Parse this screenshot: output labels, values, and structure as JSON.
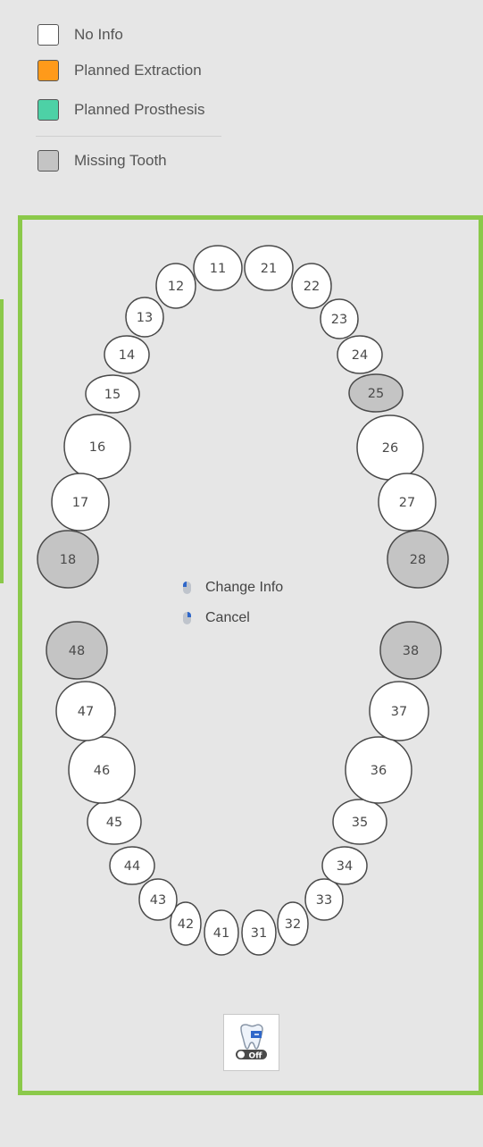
{
  "legend": {
    "items": [
      {
        "label": "No Info",
        "color": "#ffffff"
      },
      {
        "label": "Planned Extraction",
        "color": "#ff9a1a"
      },
      {
        "label": "Planned Prosthesis",
        "color": "#4dd1a6"
      },
      {
        "label": "Missing Tooth",
        "color": "#c4c4c4"
      }
    ]
  },
  "colors": {
    "panel_border": "#8bc94a",
    "tooth_fill": "#ffffff",
    "missing_fill": "#c4c4c4",
    "tooth_stroke": "#4a4a4a"
  },
  "teeth": [
    {
      "number": "11",
      "status": "no-info"
    },
    {
      "number": "12",
      "status": "no-info"
    },
    {
      "number": "13",
      "status": "no-info"
    },
    {
      "number": "14",
      "status": "no-info"
    },
    {
      "number": "15",
      "status": "no-info"
    },
    {
      "number": "16",
      "status": "no-info"
    },
    {
      "number": "17",
      "status": "no-info"
    },
    {
      "number": "18",
      "status": "missing"
    },
    {
      "number": "21",
      "status": "no-info"
    },
    {
      "number": "22",
      "status": "no-info"
    },
    {
      "number": "23",
      "status": "no-info"
    },
    {
      "number": "24",
      "status": "no-info"
    },
    {
      "number": "25",
      "status": "missing"
    },
    {
      "number": "26",
      "status": "no-info"
    },
    {
      "number": "27",
      "status": "no-info"
    },
    {
      "number": "28",
      "status": "missing"
    },
    {
      "number": "31",
      "status": "no-info"
    },
    {
      "number": "32",
      "status": "no-info"
    },
    {
      "number": "33",
      "status": "no-info"
    },
    {
      "number": "34",
      "status": "no-info"
    },
    {
      "number": "35",
      "status": "no-info"
    },
    {
      "number": "36",
      "status": "no-info"
    },
    {
      "number": "37",
      "status": "no-info"
    },
    {
      "number": "38",
      "status": "missing"
    },
    {
      "number": "41",
      "status": "no-info"
    },
    {
      "number": "42",
      "status": "no-info"
    },
    {
      "number": "43",
      "status": "no-info"
    },
    {
      "number": "44",
      "status": "no-info"
    },
    {
      "number": "45",
      "status": "no-info"
    },
    {
      "number": "46",
      "status": "no-info"
    },
    {
      "number": "47",
      "status": "no-info"
    },
    {
      "number": "48",
      "status": "missing"
    }
  ],
  "hints": {
    "left_click": "Change Info",
    "right_click": "Cancel"
  },
  "toggle": {
    "icon": "tooth-toggle-icon",
    "state": "Off"
  }
}
